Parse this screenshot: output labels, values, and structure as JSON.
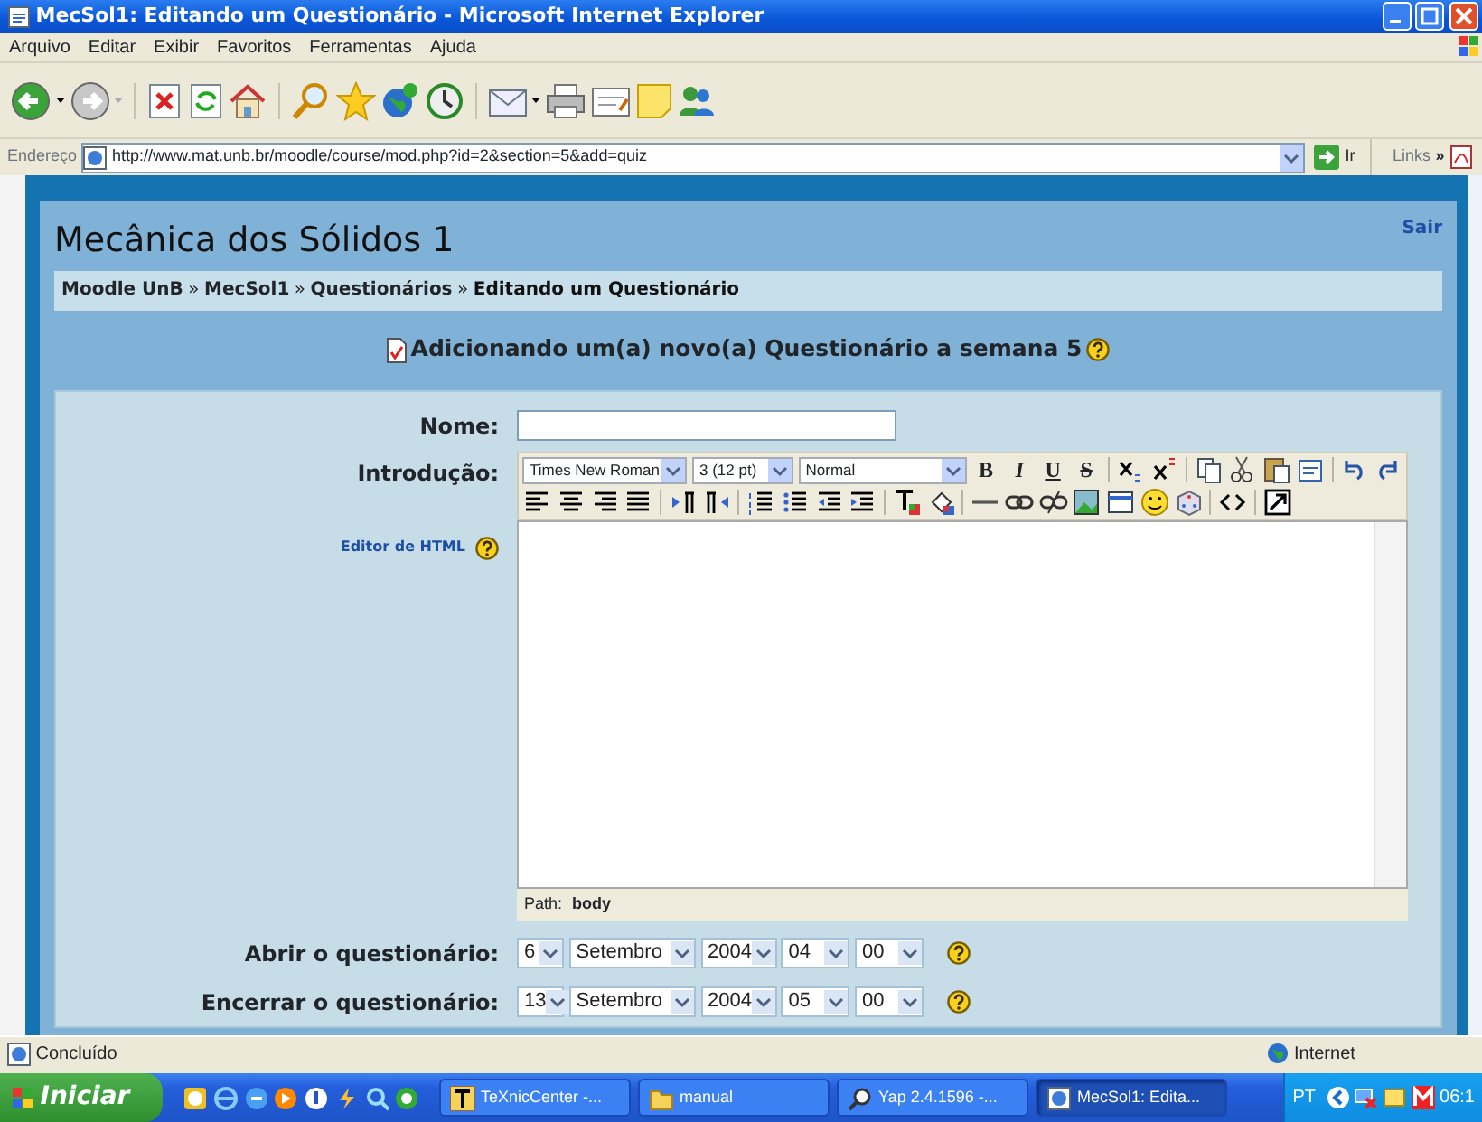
{
  "window": {
    "title": "MecSol1: Editando um Questionário - Microsoft Internet Explorer"
  },
  "menu": [
    "Arquivo",
    "Editar",
    "Exibir",
    "Favoritos",
    "Ferramentas",
    "Ajuda"
  ],
  "address": {
    "label": "Endereço",
    "url": "http://www.mat.unb.br/moodle/course/mod.php?id=2&section=5&add=quiz",
    "go": "Ir",
    "links": "Links",
    "links_more": "»"
  },
  "page": {
    "course_title": "Mecânica dos Sólidos 1",
    "logout": "Sair",
    "breadcrumb": [
      {
        "text": "Moodle UnB",
        "kind": "link"
      },
      {
        "text": "»",
        "kind": "sep"
      },
      {
        "text": "MecSol1",
        "kind": "link"
      },
      {
        "text": "»",
        "kind": "sep"
      },
      {
        "text": "Questionários",
        "kind": "link"
      },
      {
        "text": "»",
        "kind": "sep"
      },
      {
        "text": "Editando um Questionário",
        "kind": "current"
      }
    ],
    "heading": "Adicionando um(a) novo(a) Questionário a semana 5",
    "form": {
      "name_label": "Nome:",
      "intro_label": "Introdução:",
      "html_editor_link": "Editor de HTML",
      "editor": {
        "font": "Times New Roman",
        "size": "3 (12 pt)",
        "format": "Normal",
        "format_buttons": [
          "B",
          "I",
          "U",
          "S"
        ],
        "path_label": "Path:",
        "path_value": "body"
      },
      "dates": [
        {
          "label": "Abrir o questionário:",
          "fields": [
            "6",
            "Setembro",
            "2004",
            "04",
            "00"
          ]
        },
        {
          "label": "Encerrar o questionário:",
          "fields": [
            "13",
            "Setembro",
            "2004",
            "05",
            "00"
          ]
        }
      ]
    }
  },
  "status_bar": {
    "text": "Concluído",
    "zone": "Internet"
  },
  "taskbar": {
    "start": "Iniciar",
    "tasks": [
      {
        "label": "TeXnicCenter -...",
        "selected": false
      },
      {
        "label": "manual",
        "selected": false
      },
      {
        "label": "Yap 2.4.1596 -...",
        "selected": false
      },
      {
        "label": "MecSol1: Edita...",
        "selected": true
      }
    ],
    "language": "PT",
    "clock": "06:1"
  }
}
